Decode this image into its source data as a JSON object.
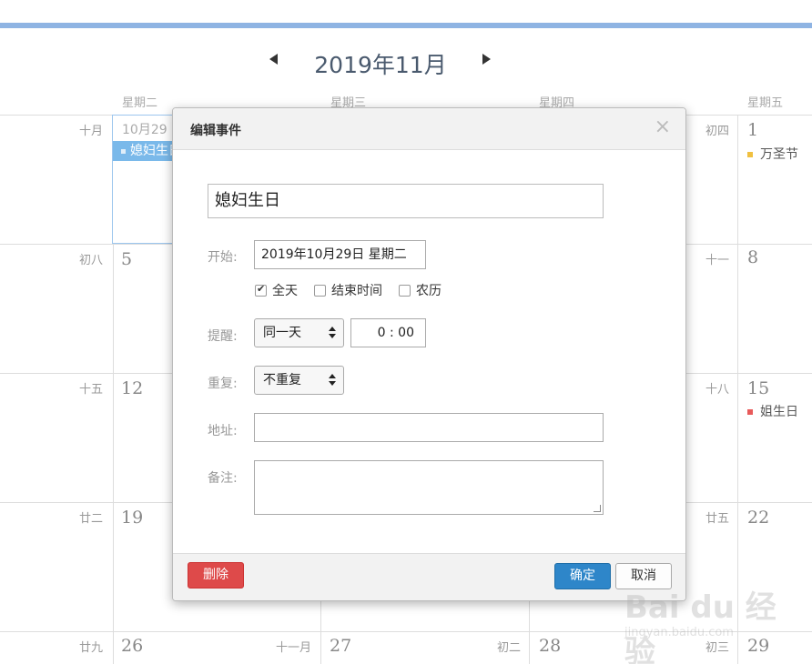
{
  "calendar": {
    "month_title": "2019年11月",
    "weekdays": [
      "星期二",
      "星期三",
      "星期四",
      "星期五"
    ],
    "rows": [
      {
        "lunar_left": "十月",
        "selected_date": "10月29",
        "lunar_right": "初四",
        "day_right": "1"
      },
      {
        "lunar_left": "初八",
        "day_left": "5",
        "lunar_right": "十一",
        "day_right": "8"
      },
      {
        "lunar_left": "十五",
        "day_left": "12",
        "lunar_right": "十八",
        "day_right": "15"
      },
      {
        "lunar_left": "廿二",
        "day_left": "19",
        "lunar_right": "廿五",
        "day_right": "22"
      },
      {
        "lunar_left": "廿九",
        "day_left": "26",
        "lunar_mid1": "十一月",
        "day_mid1": "27",
        "lunar_mid2": "初二",
        "day_mid2": "28",
        "lunar_right": "初三",
        "day_right": "29"
      }
    ],
    "events": {
      "selected_event": "媳妇生日",
      "halloween": "万圣节",
      "sister_birthday": "姐生日"
    },
    "colors": {
      "event_blue": "#7ab9ea",
      "halloween_dot": "#f0c040",
      "sister_dot": "#e85a5a"
    }
  },
  "modal": {
    "title": "编辑事件",
    "close_icon": "×",
    "event_name": "媳妇生日",
    "start_label": "开始:",
    "start_value": "2019年10月29日 星期二",
    "allday_label": "全天",
    "endtime_label": "结束时间",
    "lunar_label": "农历",
    "remind_label": "提醒:",
    "remind_day": "同一天",
    "remind_time": "0 : 00",
    "repeat_label": "重复:",
    "repeat_value": "不重复",
    "address_label": "地址:",
    "note_label": "备注:",
    "delete_button": "删除",
    "ok_button": "确定",
    "cancel_button": "取消"
  },
  "watermark": {
    "main": "Bai du 经验",
    "sub": "jingyan.baidu.com"
  }
}
